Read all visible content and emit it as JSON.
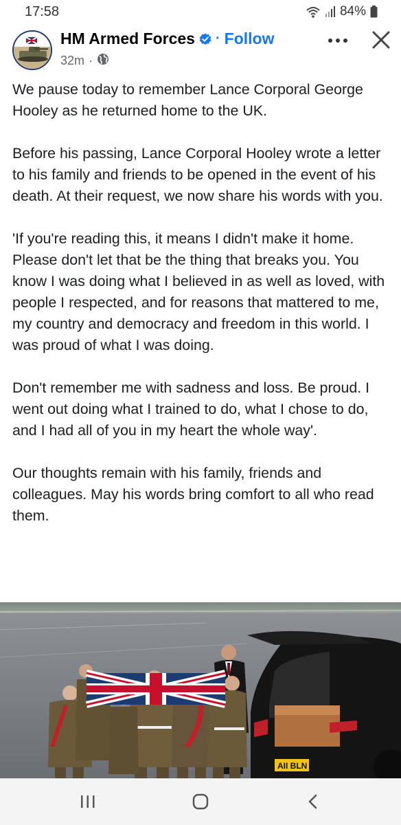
{
  "status_bar": {
    "time": "17:58",
    "battery": "84%",
    "icons": [
      "wifi-icon",
      "signal-icon",
      "battery-icon"
    ]
  },
  "post": {
    "page_name": "HM Armed Forces",
    "follow_label": "Follow",
    "separator": "·",
    "timestamp": "32m",
    "meta_separator": "·",
    "audience_icon": "globe-icon",
    "paragraphs": [
      "We pause today to remember Lance Corporal George Hooley as he returned home to the UK.",
      "Before his passing, Lance Corporal Hooley wrote a letter to his family and friends to be opened in the event of his death. At their request, we now share his words with you.",
      "'If you're reading this, it means I didn't make it home. Please don't let that be the thing that breaks you. You know I was doing what I believed in as well as loved, with people I respected, and for reasons that mattered to me, my country and democracy and freedom in this world. I was proud of what I was doing.",
      "Don't remember me with sadness and loss. Be proud. I went out doing what I trained to do, what I chose to do, and I had all of you in my heart the whole way'.",
      "Our thoughts remain with his family, friends and colleagues. May his words bring comfort to all who read them."
    ],
    "photo": {
      "plate_text": "AII BLN"
    }
  },
  "nav_bar": {
    "buttons": [
      "recent-apps-icon",
      "home-icon",
      "back-icon"
    ]
  },
  "colors": {
    "accent": "#1877f2",
    "text": "#1c1e21",
    "muted": "#65676b"
  }
}
